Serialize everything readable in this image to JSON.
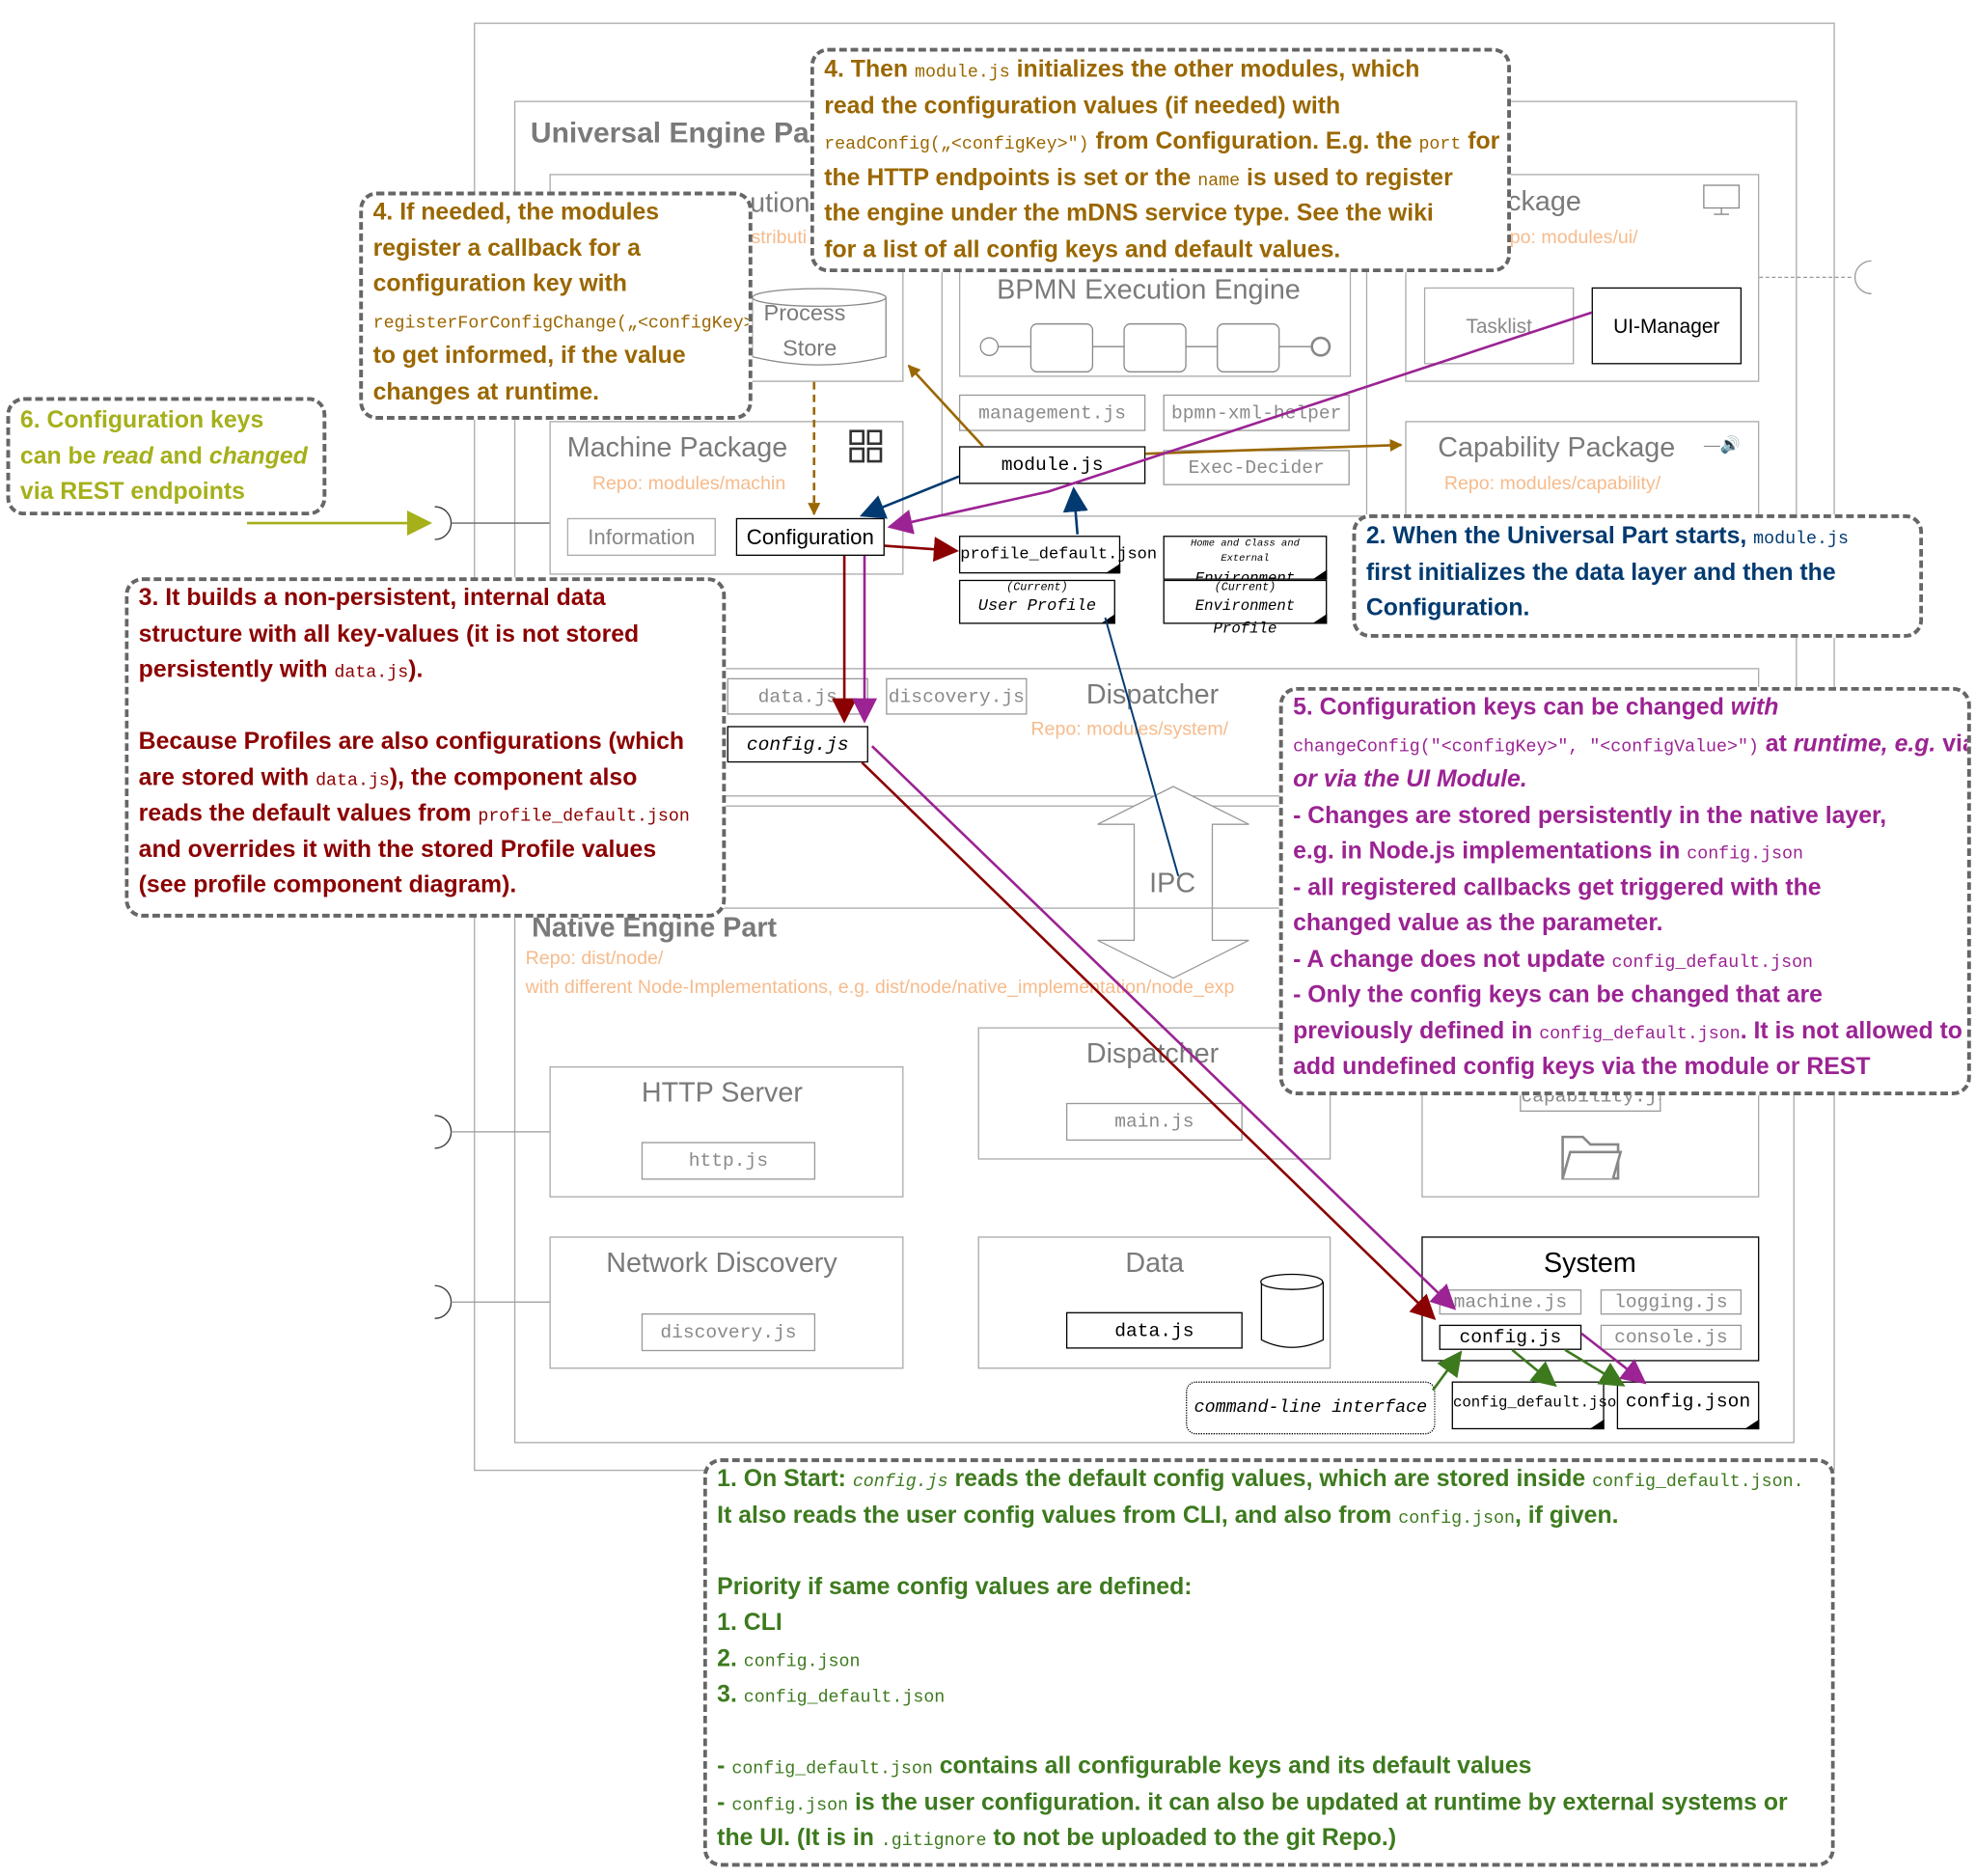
{
  "colors": {
    "note_6": "#a5b01a",
    "note_4": "#9a6700",
    "note_3": "#8b0000",
    "note_2": "#003a70",
    "note_5": "#9b2393",
    "note_1": "#3d7a1e",
    "repo": "#f6bb8c",
    "frame": "#aaaaaa"
  },
  "universal": {
    "title": "Universal Engine Pa",
    "execution_title": "ution",
    "execution_repo": "stributi",
    "process_store": [
      "Process",
      "Store"
    ],
    "bpmn_title": "BPMN Execution Engine",
    "management": "management.js",
    "bpmn_xml": "bpmn-xml-helper",
    "module": "module.js",
    "exec_decider": "Exec-Decider",
    "ui_title": "ckage",
    "ui_repo": "po: modules/ui/",
    "tasklist": "Tasklist",
    "ui_manager": "UI-Manager",
    "capability_title": "Capability Package",
    "capability_repo": "Repo: modules/capability/",
    "machine_title": "Machine Package",
    "machine_repo": "Repo: modules/machin",
    "information": "Information",
    "configuration": "Configuration",
    "profile_default": "profile_default.json",
    "user_profile_tag": "(Current)",
    "user_profile": "User Profile",
    "env_profiles_tag": "Home and Class and External",
    "env_profiles": "Environment Profiles",
    "env_profile_tag": "(Current)",
    "env_profile": "Environment Profile",
    "dispatcher_title": "Dispatcher",
    "dispatcher_repo": "Repo: modules/system/",
    "data_js": "data.js",
    "discovery_js": "discovery.js",
    "config_js": "config.js"
  },
  "ipc": "IPC",
  "native": {
    "title": "Native Engine Part",
    "repo": "Repo: dist/node/",
    "repo2": "with different Node-Implementations, e.g. dist/node/native_implementation/node_exp",
    "http_title": "HTTP Server",
    "http_js": "http.js",
    "netdisc_title": "Network Discovery",
    "discovery_js": "discovery.js",
    "dispatcher_title": "Dispatcher",
    "main_js": "main.js",
    "data_title": "Data",
    "data_js": "data.js",
    "capability_js": "capability.js",
    "system_title": "System",
    "machine_js": "machine.js",
    "logging_js": "logging.js",
    "config_js": "config.js",
    "console_js": "console.js",
    "cli": "command-line interface",
    "config_default_json": "config_default.json",
    "config_json": "config.json"
  },
  "callouts": {
    "c6": {
      "lines": [
        [
          {
            "t": " 6. Configuration keys"
          }
        ],
        [
          {
            "t": "can be "
          },
          {
            "t": "read",
            "i": 1
          },
          {
            "t": " and "
          },
          {
            "t": "changed",
            "i": 1
          }
        ],
        [
          {
            "t": "via REST endpoints"
          }
        ]
      ]
    },
    "c4a": {
      "lines": [
        [
          {
            "t": " 4. If needed, the modules"
          }
        ],
        [
          {
            "t": "register a callback for a"
          }
        ],
        [
          {
            "t": "configuration key with"
          }
        ],
        [
          {
            "t": "registerForConfigChange(„<configKey>\", clb)",
            "m": 1
          }
        ],
        [
          {
            "t": "to get informed, if the value"
          }
        ],
        [
          {
            "t": "changes at runtime."
          }
        ]
      ]
    },
    "c4b": {
      "lines": [
        [
          {
            "t": " 4. Then "
          },
          {
            "t": "module.js",
            "m": 1
          },
          {
            "t": " initializes the other modules, which"
          }
        ],
        [
          {
            "t": "read the configuration values (if needed) with"
          }
        ],
        [
          {
            "t": "readConfig(„<configKey>\")",
            "m": 1
          },
          {
            "t": " from Configuration. E.g. the "
          },
          {
            "t": "port",
            "m": 1
          },
          {
            "t": " for"
          }
        ],
        [
          {
            "t": "the HTTP endpoints is set or the "
          },
          {
            "t": "name",
            "m": 1
          },
          {
            "t": " is used to register"
          }
        ],
        [
          {
            "t": "the engine under the mDNS service type. See the wiki"
          }
        ],
        [
          {
            "t": "for a list of all config keys and default values."
          }
        ]
      ]
    },
    "c3": {
      "lines": [
        [
          {
            "t": " 3. It builds a non-persistent, internal data"
          }
        ],
        [
          {
            "t": "structure with all key-values (it is not stored"
          }
        ],
        [
          {
            "t": "persistently with "
          },
          {
            "t": "data.js",
            "m": 1
          },
          {
            "t": ")."
          }
        ],
        [
          {
            "t": ""
          }
        ],
        [
          {
            "t": "Because Profiles are also configurations (which"
          }
        ],
        [
          {
            "t": "are stored with "
          },
          {
            "t": "data.js",
            "m": 1
          },
          {
            "t": "), the component also"
          }
        ],
        [
          {
            "t": "reads the default values from "
          },
          {
            "t": "profile_default.json",
            "m": 1
          }
        ],
        [
          {
            "t": "and overrides it with the stored Profile values"
          }
        ],
        [
          {
            "t": "(see profile component diagram)."
          }
        ]
      ]
    },
    "c2": {
      "lines": [
        [
          {
            "t": " 2. When the Universal Part starts, "
          },
          {
            "t": "module.js",
            "m": 1
          }
        ],
        [
          {
            "t": "first initializes the data layer and then the"
          }
        ],
        [
          {
            "t": "Configuration."
          }
        ]
      ]
    },
    "c5": {
      "lines": [
        [
          {
            "t": " 5. Configuration keys can be changed "
          },
          {
            "t": "with",
            "i": 1
          }
        ],
        [
          {
            "t": "changeConfig(\"<configKey>\", \"<configValue>\")",
            "m": 1
          },
          {
            "t": " at "
          },
          {
            "t": "runtime, e.g.",
            "i": 1
          },
          {
            "t": " via REST"
          }
        ],
        [
          {
            "t": "or via the UI Module.",
            "i": 1
          }
        ],
        [
          {
            "t": "- Changes are stored persistently in the native layer,"
          }
        ],
        [
          {
            "t": "e.g. in Node.js implementations in "
          },
          {
            "t": "config.json",
            "m": 1
          }
        ],
        [
          {
            "t": "- all registered callbacks get triggered with the"
          }
        ],
        [
          {
            "t": "changed value as the  parameter."
          }
        ],
        [
          {
            "t": "- A change does not update "
          },
          {
            "t": "config_default.json",
            "m": 1
          }
        ],
        [
          {
            "t": "- Only the config keys can be changed that are"
          }
        ],
        [
          {
            "t": "previously defined in "
          },
          {
            "t": "config_default.json",
            "m": 1
          },
          {
            "t": ". It is not allowed to"
          }
        ],
        [
          {
            "t": "add undefined config keys via the module or REST"
          }
        ]
      ]
    },
    "c1": {
      "lines": [
        [
          {
            "t": " 1. On Start: "
          },
          {
            "t": "config.js",
            "m": 1,
            "i": 1
          },
          {
            "t": " reads the default config values, which are stored inside "
          },
          {
            "t": "config_default.json.",
            "m": 1
          }
        ],
        [
          {
            "t": "It also reads the user config values from CLI, and also from "
          },
          {
            "t": "config.json",
            "m": 1
          },
          {
            "t": ", if given."
          }
        ],
        [
          {
            "t": ""
          }
        ],
        [
          {
            "t": "Priority if same config values are defined:"
          }
        ],
        [
          {
            "t": "1. CLI"
          }
        ],
        [
          {
            "t": "2. "
          },
          {
            "t": "config.json",
            "m": 1
          }
        ],
        [
          {
            "t": "3. "
          },
          {
            "t": "config_default.json",
            "m": 1
          }
        ],
        [
          {
            "t": ""
          }
        ],
        [
          {
            "t": "- "
          },
          {
            "t": "config_default.json",
            "m": 1
          },
          {
            "t": " contains all configurable keys and its default values"
          }
        ],
        [
          {
            "t": "- "
          },
          {
            "t": "config.json",
            "m": 1
          },
          {
            "t": " is the user configuration. it can also be updated at runtime by external systems or"
          }
        ],
        [
          {
            "t": "the UI. (It is in "
          },
          {
            "t": ".gitignore",
            "m": 1
          },
          {
            "t": " to not be uploaded to the git Repo.)"
          }
        ]
      ]
    }
  }
}
